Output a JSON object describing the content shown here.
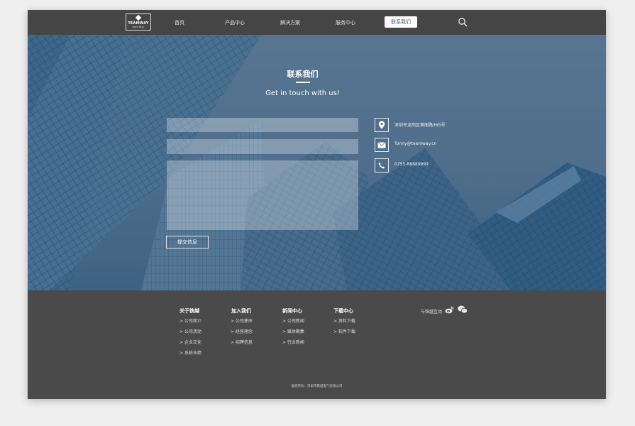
{
  "logo": {
    "name": "TEAMWAY",
    "sub": "ELECTRIC"
  },
  "nav": {
    "items": [
      {
        "label": "首页"
      },
      {
        "label": "产品中心"
      },
      {
        "label": "解决方案"
      },
      {
        "label": "服务中心"
      },
      {
        "label": "联系我们"
      }
    ],
    "active_color": "#3a5a8c"
  },
  "hero": {
    "title": "联系我们",
    "subtitle": "Get in touch with us!",
    "submit_label": "提交信息"
  },
  "contact": {
    "address": "深圳市龙岗区黄阁路365号",
    "email": "Tonny@teamway.cn",
    "phone": "0755-88889999"
  },
  "footer": {
    "columns": [
      {
        "title": "关于铁越",
        "links": [
          "> 公司简介",
          "> 公司活动",
          "> 企业文化",
          "> 系统业绩"
        ]
      },
      {
        "title": "加入我们",
        "links": [
          "> 公司使命",
          "> 经营理念",
          "> 招聘信息"
        ]
      },
      {
        "title": "新闻中心",
        "links": [
          "> 公司新闻",
          "> 媒体聚集",
          "> 行业新闻"
        ]
      },
      {
        "title": "下载中心",
        "links": [
          "> 资料下载",
          "> 软件下载"
        ]
      }
    ],
    "social_label": "与铁越互动",
    "copyright": "版权所有：深圳市铁越电气有限公司"
  },
  "colors": {
    "page_bg": "#efefef",
    "header_bg": "#454545",
    "footer_bg": "#4a4a4a",
    "hero_blue": "#557591"
  }
}
